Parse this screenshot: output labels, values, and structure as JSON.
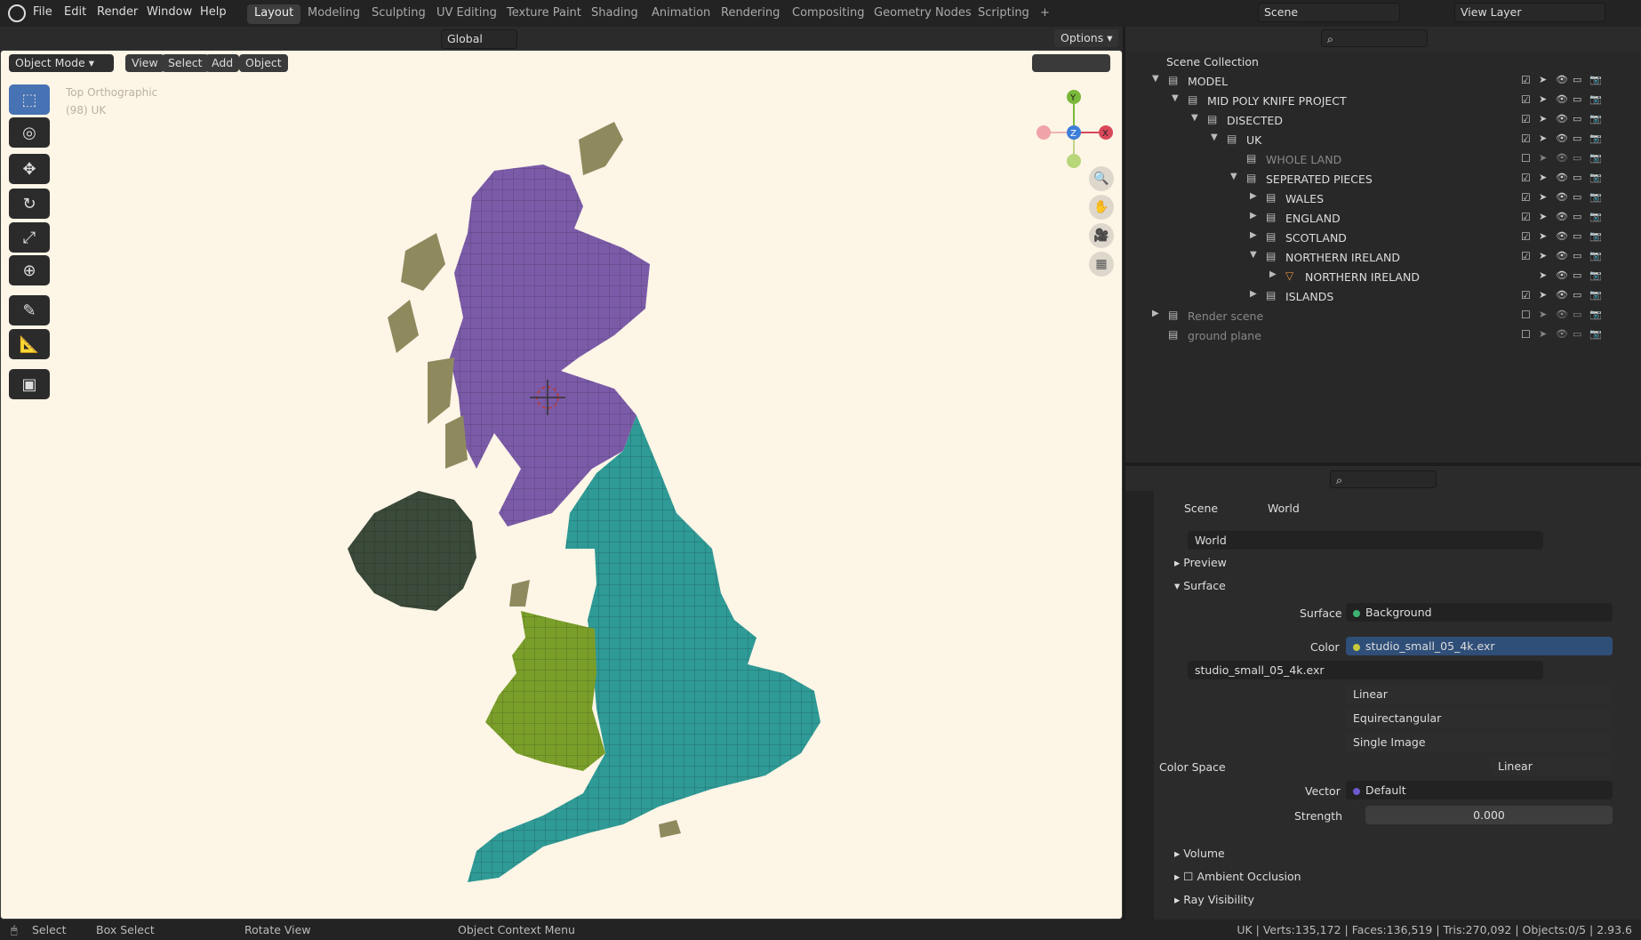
{
  "app": {
    "logo": "blender-icon"
  },
  "menus": [
    "File",
    "Edit",
    "Render",
    "Window",
    "Help"
  ],
  "workspaces": [
    "Layout",
    "Modeling",
    "Sculpting",
    "UV Editing",
    "Texture Paint",
    "Shading",
    "Animation",
    "Rendering",
    "Compositing",
    "Geometry Nodes",
    "Scripting"
  ],
  "active_workspace": "Layout",
  "scene": {
    "name": "Scene",
    "view_layer": "View Layer"
  },
  "header": {
    "transform_orientation": "Global",
    "options": "Options"
  },
  "viewport_header": {
    "mode": "Object Mode",
    "view": "View",
    "select": "Select",
    "add": "Add",
    "object": "Object"
  },
  "viewport": {
    "view_name": "Top Orthographic",
    "collection_info": "(98) UK",
    "map_colors": {
      "scotland": "#7b5ba8",
      "england": "#2f9a96",
      "wales": "#7a9e2a",
      "northern_ireland": "#3b4a3a",
      "islands": "#8e8a5e",
      "background": "#fdf5e6"
    },
    "gizmo": {
      "x": "X",
      "y": "Y",
      "z": "Z"
    }
  },
  "tools": [
    "select-box-icon",
    "cursor-icon",
    "move-icon",
    "rotate-icon",
    "scale-icon",
    "transform-icon",
    "annotate-icon",
    "measure-icon",
    "add-cube-icon"
  ],
  "outliner": {
    "root": "Scene Collection",
    "rows": [
      {
        "label": "MODEL",
        "depth": 0,
        "expanded": true,
        "checked": true,
        "dim": false
      },
      {
        "label": "MID POLY KNIFE PROJECT",
        "depth": 1,
        "expanded": true,
        "checked": true,
        "dim": false
      },
      {
        "label": "DISECTED",
        "depth": 2,
        "expanded": true,
        "checked": true,
        "dim": false
      },
      {
        "label": "UK",
        "depth": 3,
        "expanded": true,
        "checked": true,
        "dim": false
      },
      {
        "label": "WHOLE LAND",
        "depth": 4,
        "expanded": null,
        "checked": false,
        "dim": true
      },
      {
        "label": "SEPERATED PIECES",
        "depth": 4,
        "expanded": true,
        "checked": true,
        "dim": false
      },
      {
        "label": "WALES",
        "depth": 5,
        "expanded": false,
        "checked": true,
        "dim": false
      },
      {
        "label": "ENGLAND",
        "depth": 5,
        "expanded": false,
        "checked": true,
        "dim": false
      },
      {
        "label": "SCOTLAND",
        "depth": 5,
        "expanded": false,
        "checked": true,
        "dim": false
      },
      {
        "label": "NORTHERN IRELAND",
        "depth": 5,
        "expanded": true,
        "checked": true,
        "dim": false
      },
      {
        "label": "NORTHERN IRELAND",
        "depth": 6,
        "expanded": false,
        "checked": null,
        "dim": false
      },
      {
        "label": "ISLANDS",
        "depth": 5,
        "expanded": false,
        "checked": true,
        "dim": false
      },
      {
        "label": "Render scene",
        "depth": 0,
        "expanded": false,
        "checked": false,
        "dim": true
      },
      {
        "label": "ground plane",
        "depth": 0,
        "expanded": null,
        "checked": false,
        "dim": true
      }
    ]
  },
  "properties": {
    "breadcrumb": [
      "Scene",
      "World"
    ],
    "world_name": "World",
    "panels": {
      "preview": "Preview",
      "surface": "Surface",
      "volume": "Volume",
      "ambient_occlusion": "Ambient Occlusion",
      "ray_visibility": "Ray Visibility"
    },
    "surface_label": "Surface",
    "surface_value": "Background",
    "color_label": "Color",
    "color_value": "studio_small_05_4k.exr",
    "image_name": "studio_small_05_4k.exr",
    "interpolation": "Linear",
    "projection": "Equirectangular",
    "source": "Single Image",
    "color_space_label": "Color Space",
    "color_space": "Linear",
    "vector_label": "Vector",
    "vector_value": "Default",
    "strength_label": "Strength",
    "strength_value": "0.000"
  },
  "statusbar": {
    "select": "Select",
    "box_select": "Box Select",
    "rotate_view": "Rotate View",
    "context_menu": "Object Context Menu",
    "stats": "UK | Verts:135,172 | Faces:136,519 | Tris:270,092 | Objects:0/5 | 2.93.6"
  }
}
